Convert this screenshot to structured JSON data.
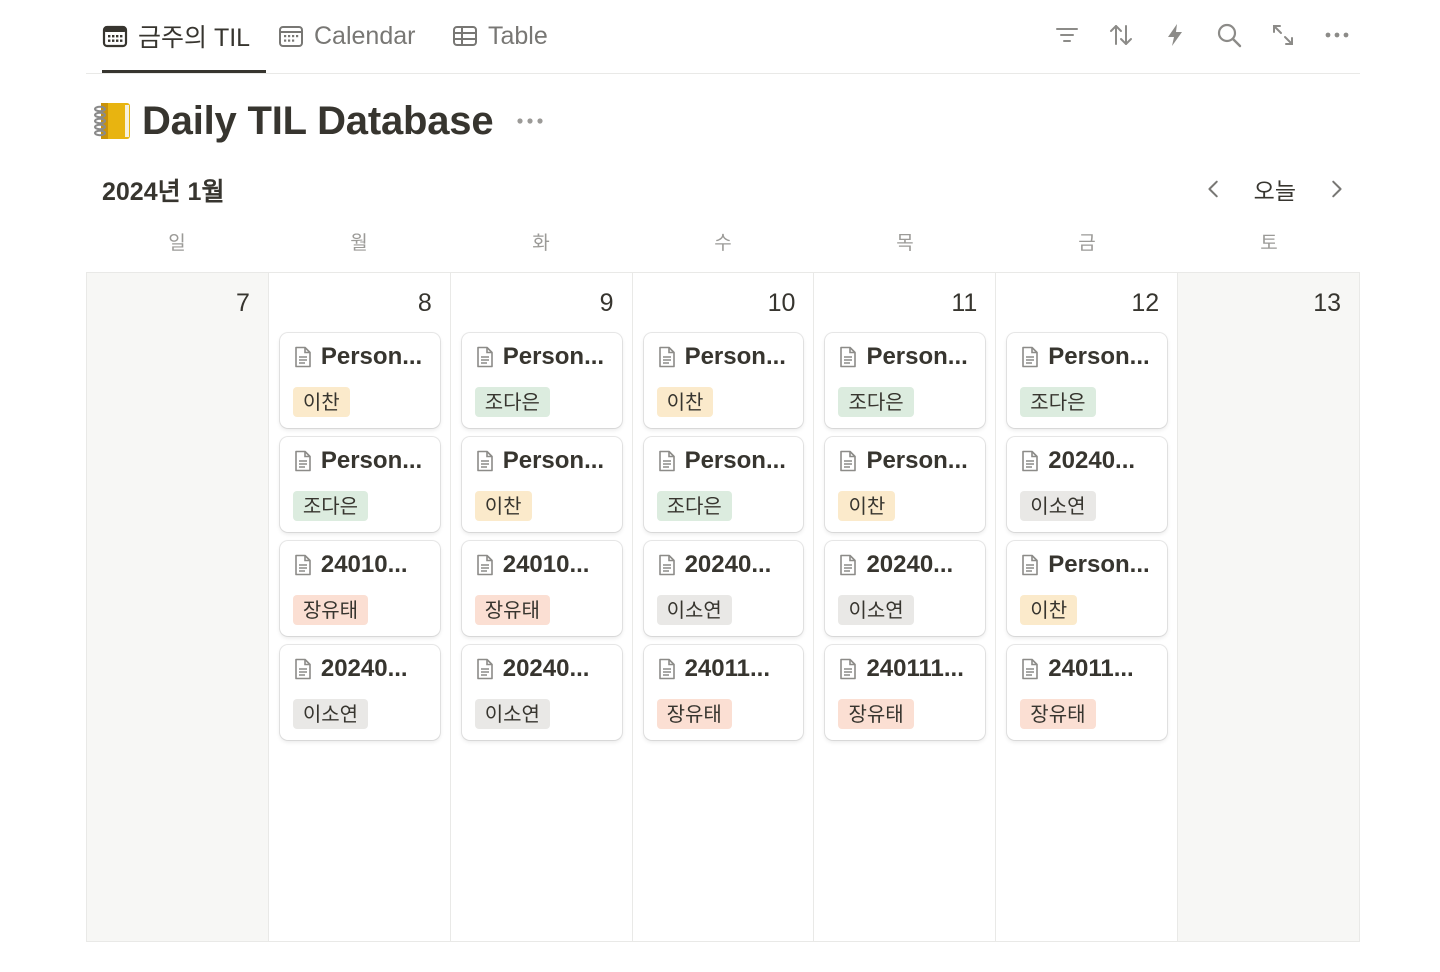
{
  "tabs": [
    {
      "label": "금주의 TIL",
      "icon": "calendar-icon",
      "active": true
    },
    {
      "label": "Calendar",
      "icon": "calendar-icon",
      "active": false
    },
    {
      "label": "Table",
      "icon": "table-icon",
      "active": false
    }
  ],
  "toolbar": [
    "filter-icon",
    "sort-icon",
    "automation-bolt-icon",
    "search-icon",
    "expand-icon",
    "more-icon"
  ],
  "title": {
    "emoji": "notebook-icon",
    "text": "Daily TIL Database"
  },
  "month": {
    "label": "2024년 1월",
    "today_label": "오늘"
  },
  "weekdays": [
    "일",
    "월",
    "화",
    "수",
    "목",
    "금",
    "토"
  ],
  "tag_colors": {
    "이찬": "#fbeacb",
    "조다은": "#dcecdf",
    "장유태": "#fbdfd3",
    "이소연": "#e9e8e6"
  },
  "days": [
    {
      "num": "7",
      "weekend": true,
      "cards": []
    },
    {
      "num": "8",
      "weekend": false,
      "cards": [
        {
          "title": "Person...",
          "tag": "이찬"
        },
        {
          "title": "Person...",
          "tag": "조다은"
        },
        {
          "title": "24010...",
          "tag": "장유태"
        },
        {
          "title": "20240...",
          "tag": "이소연"
        }
      ]
    },
    {
      "num": "9",
      "weekend": false,
      "cards": [
        {
          "title": "Person...",
          "tag": "조다은"
        },
        {
          "title": "Person...",
          "tag": "이찬"
        },
        {
          "title": "24010...",
          "tag": "장유태"
        },
        {
          "title": "20240...",
          "tag": "이소연"
        }
      ]
    },
    {
      "num": "10",
      "weekend": false,
      "cards": [
        {
          "title": "Person...",
          "tag": "이찬"
        },
        {
          "title": "Person...",
          "tag": "조다은"
        },
        {
          "title": "20240...",
          "tag": "이소연"
        },
        {
          "title": "24011...",
          "tag": "장유태"
        }
      ]
    },
    {
      "num": "11",
      "weekend": false,
      "cards": [
        {
          "title": "Person...",
          "tag": "조다은"
        },
        {
          "title": "Person...",
          "tag": "이찬"
        },
        {
          "title": "20240...",
          "tag": "이소연"
        },
        {
          "title": "240111...",
          "tag": "장유태"
        }
      ]
    },
    {
      "num": "12",
      "weekend": false,
      "cards": [
        {
          "title": "Person...",
          "tag": "조다은"
        },
        {
          "title": "20240...",
          "tag": "이소연"
        },
        {
          "title": "Person...",
          "tag": "이찬"
        },
        {
          "title": "24011...",
          "tag": "장유태"
        }
      ]
    },
    {
      "num": "13",
      "weekend": true,
      "cards": []
    }
  ]
}
